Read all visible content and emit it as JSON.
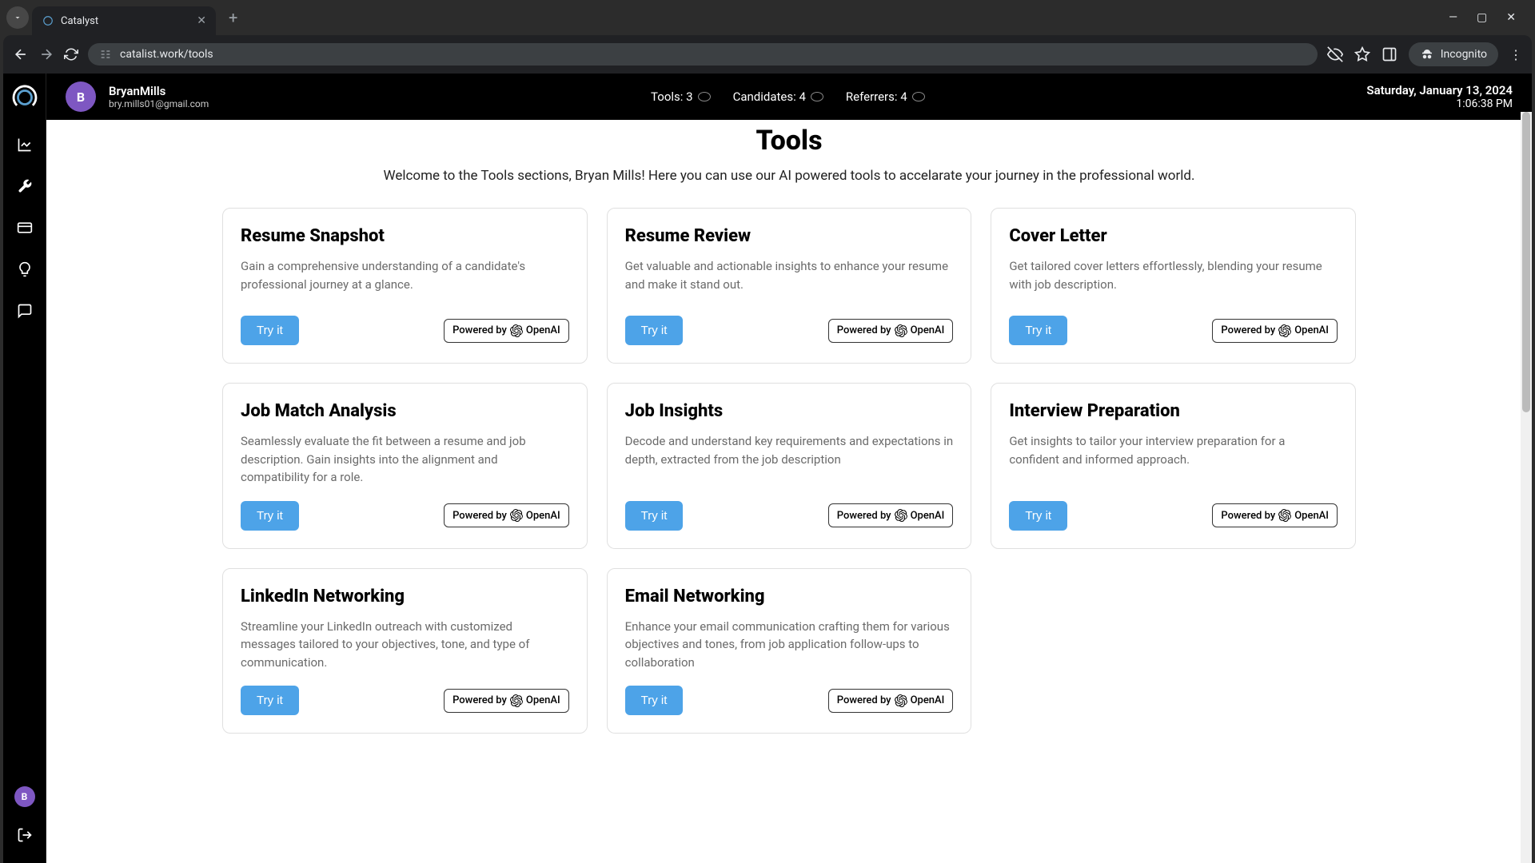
{
  "browser": {
    "tab_title": "Catalyst",
    "url": "catalist.work/tools",
    "incognito_label": "Incognito"
  },
  "header": {
    "username": "BryanMills",
    "email": "bry.mills01@gmail.com",
    "avatar_letter": "B",
    "stats": {
      "tools": "Tools: 3",
      "candidates": "Candidates: 4",
      "referrers": "Referrers: 4"
    },
    "date": "Saturday, January 13, 2024",
    "time": "1:06:38 PM"
  },
  "page": {
    "title": "Tools",
    "subtitle": "Welcome to the Tools sections, Bryan Mills! Here you can use our AI powered tools to accelarate your journey in the professional world."
  },
  "common": {
    "try_button": "Try it",
    "powered_prefix": "Powered by",
    "powered_brand": "OpenAI"
  },
  "tools": [
    {
      "title": "Resume Snapshot",
      "desc": "Gain a comprehensive understanding of a candidate's professional journey at a glance."
    },
    {
      "title": "Resume Review",
      "desc": "Get valuable and actionable insights to enhance your resume and make it stand out."
    },
    {
      "title": "Cover Letter",
      "desc": "Get tailored cover letters effortlessly, blending your resume with job description."
    },
    {
      "title": "Job Match Analysis",
      "desc": "Seamlessly evaluate the fit between a resume and job description. Gain insights into the alignment and compatibility for a role."
    },
    {
      "title": "Job Insights",
      "desc": "Decode and understand key requirements and expectations in depth, extracted from the job description"
    },
    {
      "title": "Interview Preparation",
      "desc": "Get insights to tailor your interview preparation for a confident and informed approach."
    },
    {
      "title": "LinkedIn Networking",
      "desc": "Streamline your LinkedIn outreach with customized messages tailored to your objectives, tone, and type of communication."
    },
    {
      "title": "Email Networking",
      "desc": "Enhance your email communication crafting them for various objectives and tones, from job application follow-ups to collaboration"
    }
  ],
  "sidebar": {
    "avatar_letter": "B"
  }
}
